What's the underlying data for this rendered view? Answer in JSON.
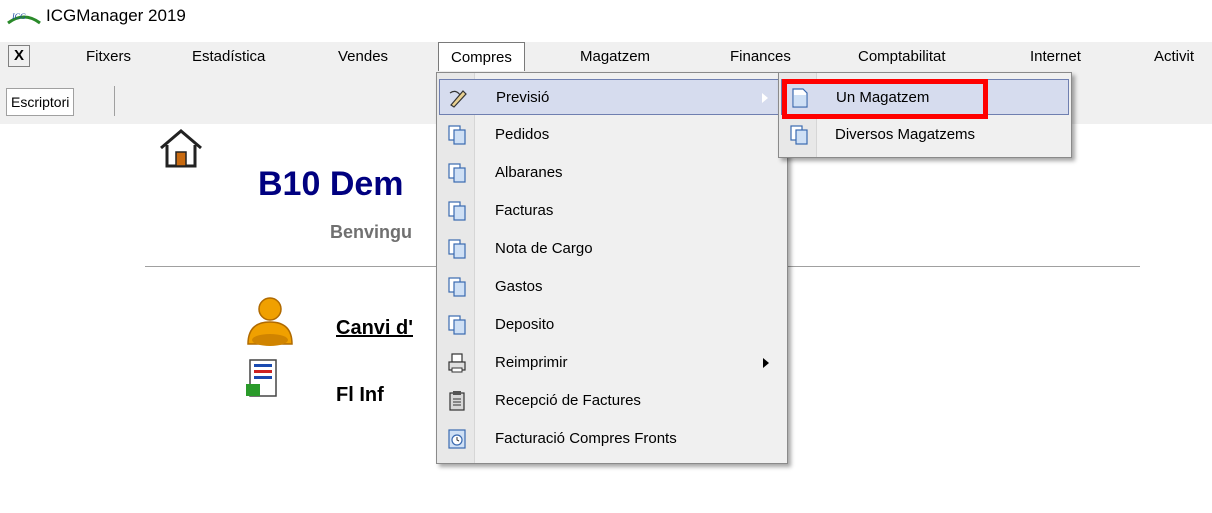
{
  "app": {
    "title": "ICGManager 2019",
    "logo_text": "ICG"
  },
  "menubar": {
    "close_label": "X",
    "items": [
      "Fitxers",
      "Estadística",
      "Vendes",
      "Compres",
      "Magatzem",
      "Finances",
      "Comptabilitat",
      "Internet",
      "Activit"
    ]
  },
  "tabs": {
    "escriptori": "Escriptori"
  },
  "dashboard": {
    "company_title": "B10 Dem",
    "welcome": "Benvingu",
    "canvi_link": "Canvi d'",
    "report_link": "Fl         Inf"
  },
  "compres_menu": {
    "items": [
      {
        "label": "Previsió",
        "icon": "pencil-icon",
        "submenu": true,
        "highlighted": true
      },
      {
        "label": "Pedidos",
        "icon": "document-icon"
      },
      {
        "label": "Albaranes",
        "icon": "document-icon"
      },
      {
        "label": "Facturas",
        "icon": "document-icon"
      },
      {
        "label": "Nota de Cargo",
        "icon": "document-icon"
      },
      {
        "label": "Gastos",
        "icon": "document-icon"
      },
      {
        "label": "Deposito",
        "icon": "document-icon"
      },
      {
        "label": "Reimprimir",
        "icon": "printer-icon",
        "submenu": true
      },
      {
        "label": "Recepció de Factures",
        "icon": "clipboard-icon"
      },
      {
        "label": "Facturació Compres Fronts",
        "icon": "clock-document-icon"
      }
    ]
  },
  "previsio_submenu": {
    "items": [
      {
        "label": "Un Magatzem",
        "icon": "document-icon",
        "highlighted": true
      },
      {
        "label": "Diversos Magatzems",
        "icon": "documents-icon"
      }
    ]
  },
  "colors": {
    "highlight": "#d6dcee",
    "title_blue": "#000080",
    "annotation_red": "#ff0000"
  }
}
